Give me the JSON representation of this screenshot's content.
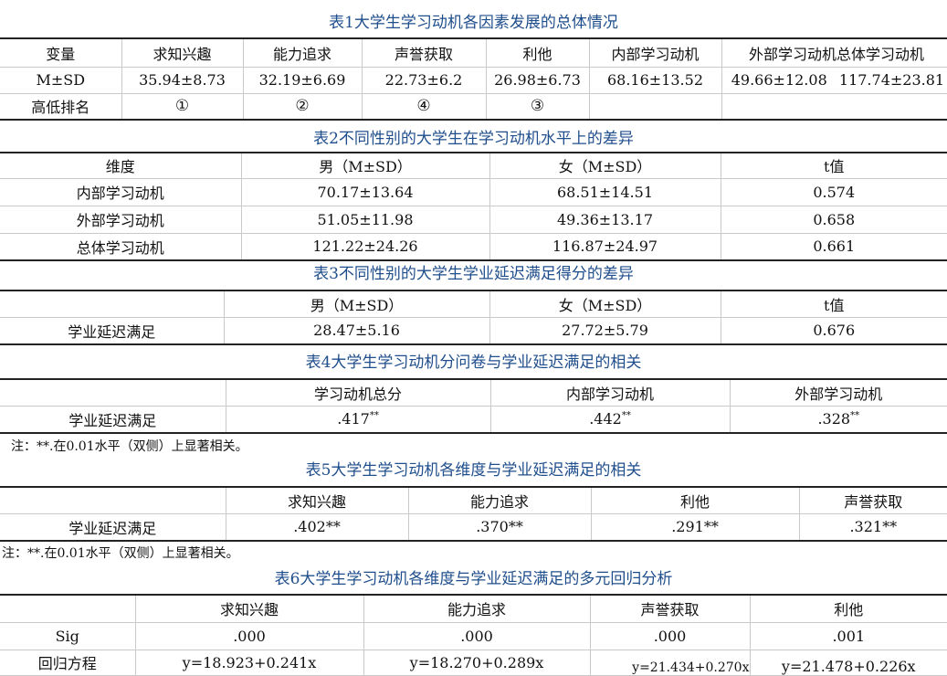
{
  "table1": {
    "title": "表1大学生学习动机各因素发展的总体情况",
    "headers": [
      "变量",
      "求知兴趣",
      "能力追求",
      "声誉获取",
      "利他",
      "内部学习动机",
      "外部学习动机",
      "总体学习动机"
    ],
    "row_msd": {
      "label": "M±SD",
      "values": [
        "35.94±8.73",
        "32.19±6.69",
        "22.73±6.2",
        "26.98±6.73",
        "68.16±13.52",
        "49.66±12.08",
        "117.74±23.81"
      ]
    },
    "row_rank": {
      "label": "高低排名",
      "values": [
        "①",
        "②",
        "④",
        "③"
      ]
    }
  },
  "table2": {
    "title": "表2不同性别的大学生在学习动机水平上的差异",
    "headers": [
      "维度",
      "男（M±SD）",
      "女（M±SD）",
      "t值"
    ],
    "rows": [
      [
        "内部学习动机",
        "70.17±13.64",
        "68.51±14.51",
        "0.574"
      ],
      [
        "外部学习动机",
        "51.05±11.98",
        "49.36±13.17",
        "0.658"
      ],
      [
        "总体学习动机",
        "121.22±24.26",
        "116.87±24.97",
        "0.661"
      ]
    ]
  },
  "table3": {
    "title": "表3不同性别的大学生学业延迟满足得分的差异",
    "headers": [
      "",
      "男（M±SD）",
      "女（M±SD）",
      "t值"
    ],
    "rows": [
      [
        "学业延迟满足",
        "28.47±5.16",
        "27.72±5.79",
        "0.676"
      ]
    ]
  },
  "table4": {
    "title": "表4大学生学习动机分问卷与学业延迟满足的相关",
    "headers": [
      "",
      "学习动机总分",
      "内部学习动机",
      "外部学习动机"
    ],
    "row": {
      "label": "学业延迟满足",
      "values": [
        ".417",
        ".442",
        ".328"
      ],
      "mark": "**"
    },
    "note": "注：**.在0.01水平（双侧）上显著相关。"
  },
  "table5": {
    "title": "表5大学生学习动机各维度与学业延迟满足的相关",
    "headers": [
      "",
      "求知兴趣",
      "能力追求",
      "利他",
      "声誉获取"
    ],
    "row": {
      "label": "学业延迟满足",
      "values": [
        ".402**",
        ".370**",
        ".291**",
        ".321**"
      ]
    },
    "note": "注：**.在0.01水平（双侧）上显著相关。"
  },
  "table6": {
    "title": "表6大学生学习动机各维度与学业延迟满足的多元回归分析",
    "headers": [
      "",
      "求知兴趣",
      "能力追求",
      "声誉获取",
      "利他"
    ],
    "row_sig": {
      "label": "Sig",
      "values": [
        ".000",
        ".000",
        ".000",
        ".001"
      ]
    },
    "row_eq": {
      "label": "回归方程",
      "values": [
        "y=18.923+0.241x",
        "y=18.270+0.289x",
        "y=21.434+0.270x",
        "y=21.478+0.226x"
      ]
    }
  }
}
